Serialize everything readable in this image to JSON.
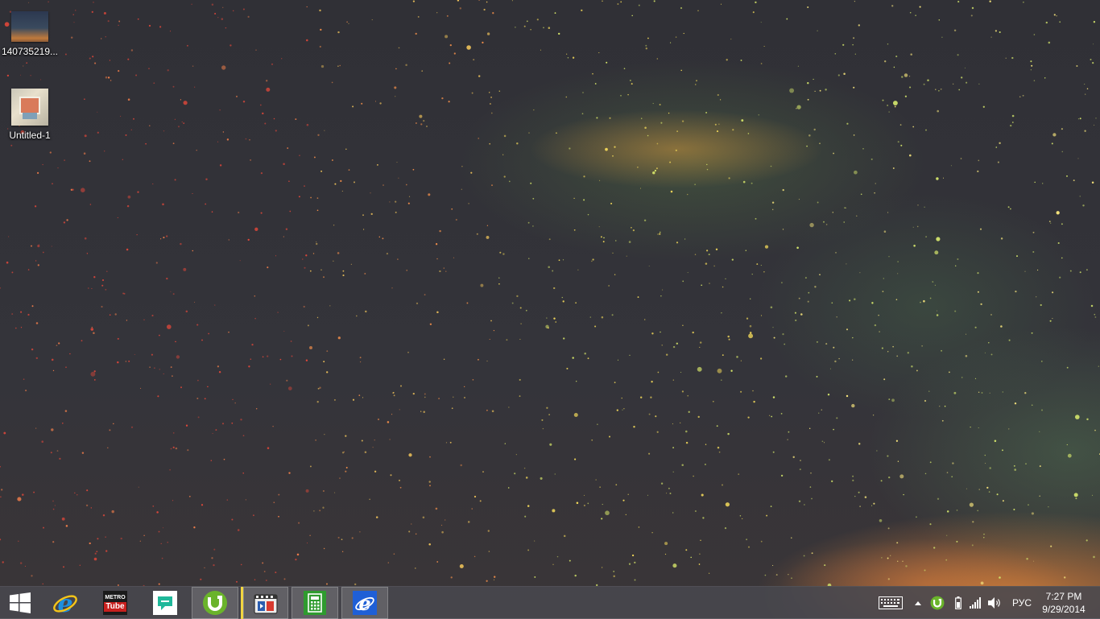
{
  "desktop": {
    "icons": [
      {
        "label": "140735219...",
        "icon": "image-thumbnail-icon"
      },
      {
        "label": "Untitled-1",
        "icon": "image-thumbnail-icon"
      }
    ]
  },
  "taskbar": {
    "start": {
      "icon": "windows-logo-icon"
    },
    "pinned": [
      {
        "name": "Internet Explorer",
        "icon": "internet-explorer-icon",
        "active": false
      },
      {
        "name": "MetroTube",
        "icon": "metrotube-icon",
        "top_text": "METRO",
        "bottom_text": "Tube",
        "active": false
      },
      {
        "name": "Messaging",
        "icon": "chat-icon",
        "active": false
      },
      {
        "name": "uTorrent",
        "icon": "utorrent-icon",
        "active": true
      },
      {
        "name": "Media Player Classic",
        "icon": "media-player-icon",
        "active": true
      },
      {
        "name": "Calculator",
        "icon": "calculator-icon",
        "active": true
      },
      {
        "name": "Internet Explorer",
        "icon": "internet-explorer-icon",
        "active": true
      }
    ]
  },
  "tray": {
    "keyboard_icon": "touch-keyboard-icon",
    "show_hidden_icon": "chevron-up-icon",
    "utorrent_icon": "utorrent-icon",
    "battery_icon": "battery-icon",
    "network_icon": "signal-bars-icon",
    "volume_icon": "speaker-icon",
    "language": "РУС",
    "time": "7:27 PM",
    "date": "9/29/2014"
  },
  "colors": {
    "taskbar": "#48484e",
    "ie_blue": "#1e8fe0",
    "utorrent_green": "#6ab42b",
    "metrotube_red": "#c8201e",
    "chat_teal": "#1fb89a",
    "calc_green": "#2f9b2f",
    "pinned_separator": "#f2d640"
  }
}
